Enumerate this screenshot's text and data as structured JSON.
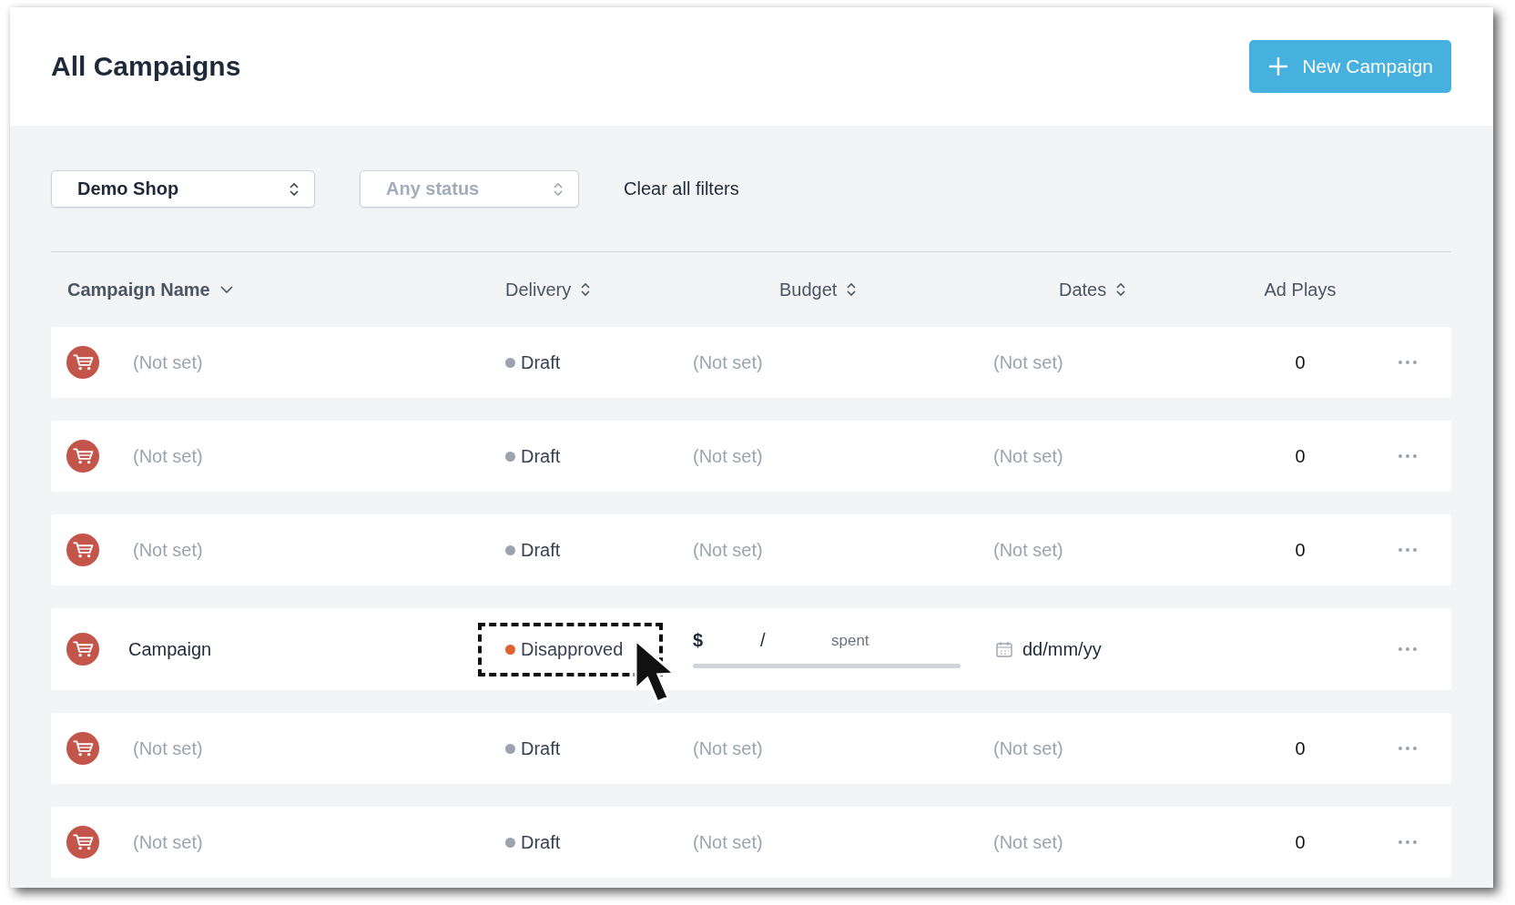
{
  "title": "All Campaigns",
  "new_button": {
    "label": "New Campaign"
  },
  "filters": [
    {
      "kind": "select",
      "value": "Demo Shop"
    },
    {
      "kind": "select",
      "placeholder": "Any status"
    },
    {
      "kind": "link",
      "value": "Clear all filters"
    }
  ],
  "columns": [
    {
      "label": "Campaign Name",
      "kind": "sorted"
    },
    {
      "label": "Delivery",
      "kind": "sortable"
    },
    {
      "label": "Budget",
      "kind": "sortable"
    },
    {
      "label": "Dates",
      "kind": "sortable"
    },
    {
      "label": "Ad Plays",
      "kind": "plain"
    }
  ],
  "rows": [
    {
      "kind": "empty",
      "name": "(Not set)",
      "delivery": {
        "label": "Draft",
        "color": "#9ca3af",
        "highlighted": false
      },
      "budget": "(Not set)",
      "dates": "(Not set)",
      "ad_plays": "0"
    },
    {
      "kind": "empty",
      "name": "(Not set)",
      "delivery": {
        "label": "Draft",
        "color": "#9ca3af",
        "highlighted": false
      },
      "budget": "(Not set)",
      "dates": "(Not set)",
      "ad_plays": "0"
    },
    {
      "kind": "empty",
      "name": "(Not set)",
      "delivery": {
        "label": "Draft",
        "color": "#9ca3af",
        "highlighted": false
      },
      "budget": "(Not set)",
      "dates": "(Not set)",
      "ad_plays": "0"
    },
    {
      "kind": "active",
      "name": "Campaign",
      "delivery": {
        "label": "Disapproved",
        "color": "#e0602f",
        "highlighted": true
      },
      "budget": {
        "currency": "$",
        "separator": "/",
        "spent": "spent"
      },
      "dates": "dd/mm/yy"
    },
    {
      "kind": "empty",
      "name": "(Not set)",
      "delivery": {
        "label": "Draft",
        "color": "#9ca3af",
        "highlighted": false
      },
      "budget": "(Not set)",
      "dates": "(Not set)",
      "ad_plays": "0"
    },
    {
      "kind": "empty",
      "name": "(Not set)",
      "delivery": {
        "label": "Draft",
        "color": "#9ca3af",
        "highlighted": false
      },
      "budget": "(Not set)",
      "dates": "(Not set)",
      "ad_plays": "0"
    }
  ]
}
